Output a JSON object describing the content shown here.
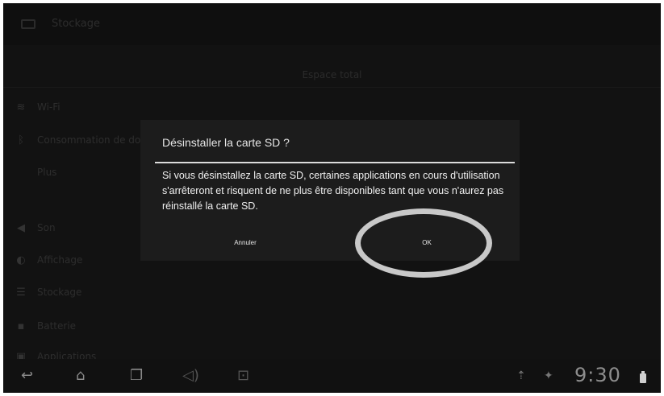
{
  "app_bar": {
    "title": "Stockage"
  },
  "settings": {
    "section_header": "Espace total",
    "items": [
      {
        "icon": "wifi-icon",
        "glyph": "≋",
        "label": "Wi-Fi"
      },
      {
        "icon": "bluetooth-icon",
        "glyph": "ᛒ",
        "label": "Consommation de données"
      },
      {
        "icon": "more-icon",
        "glyph": "",
        "label": "Plus"
      },
      {
        "icon": "sound-icon",
        "glyph": "◀",
        "label": "Son"
      },
      {
        "icon": "display-icon",
        "glyph": "◐",
        "label": "Affichage"
      },
      {
        "icon": "storage-icon",
        "glyph": "☰",
        "label": "Stockage"
      },
      {
        "icon": "battery-settings-icon",
        "glyph": "▪",
        "label": "Batterie"
      },
      {
        "icon": "apps-icon",
        "glyph": "▣",
        "label": "Applications"
      }
    ]
  },
  "dialog": {
    "title": "Désinstaller la carte SD ?",
    "message": "Si vous désinstallez la carte SD, certaines applications en cours d'utilisation s'arrêteront et risquent de ne plus être disponibles tant que vous n'aurez pas réinstallé la carte SD.",
    "cancel_label": "Annuler",
    "ok_label": "OK"
  },
  "navbar": {
    "back_glyph": "↩",
    "home_glyph": "⌂",
    "recent_glyph": "❐",
    "volume_glyph": "◁)",
    "screenshot_glyph": "⊡",
    "usb_glyph": "⇡",
    "sd_glyph": "✦",
    "time": "9:30"
  },
  "colors": {
    "screen_bg": "#181818",
    "dialog_bg": "#1c1c1c",
    "dialog_text": "#f0f0f0",
    "divider": "#dcdcdc",
    "highlight_ring": "#c8c8c8"
  }
}
